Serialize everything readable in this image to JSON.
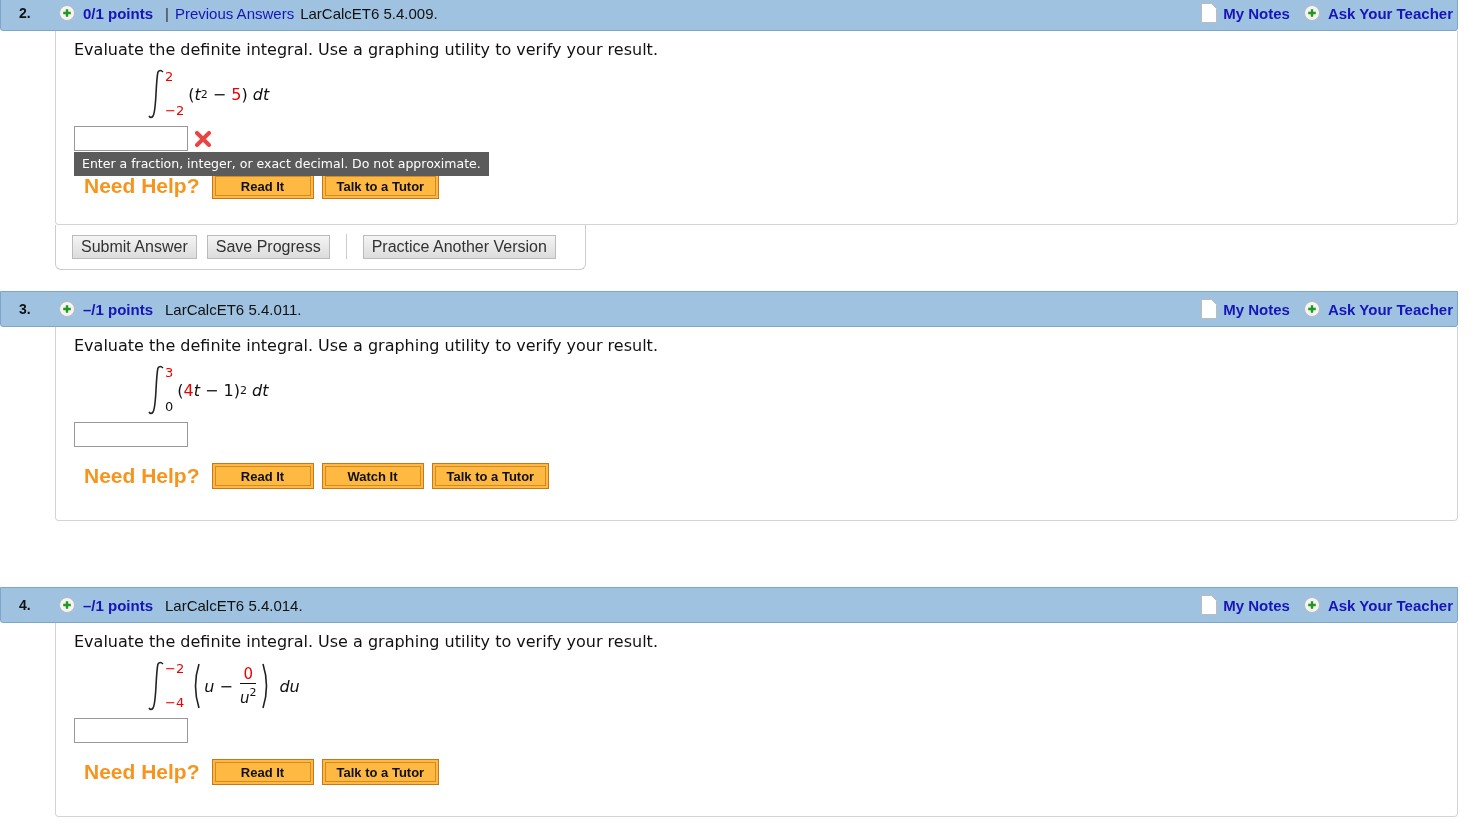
{
  "questions": [
    {
      "number": "2.",
      "points": "0/1 points",
      "separator": "|",
      "previous_answers": "Previous Answers",
      "code": "LarCalcET6 5.4.009.",
      "my_notes": "My Notes",
      "ask_teacher": "Ask Your Teacher",
      "prompt": "Evaluate the definite integral. Use a graphing utility to verify your result.",
      "integral": {
        "upper": {
          "text": "2",
          "given": true
        },
        "lower": {
          "text": "−2",
          "given": true
        },
        "pieces": [
          {
            "kind": "text",
            "text": "("
          },
          {
            "kind": "var",
            "text": "t"
          },
          {
            "kind": "sup",
            "text": "2"
          },
          {
            "kind": "text",
            "text": " − "
          },
          {
            "kind": "given",
            "text": "5"
          },
          {
            "kind": "text",
            "text": ")"
          },
          {
            "kind": "differential",
            "text": "dt"
          }
        ]
      },
      "answer": {
        "incorrect": true,
        "tooltip": "Enter a fraction, integer, or exact decimal. Do not approximate."
      },
      "help_label": "Need Help?",
      "help_buttons": [
        "Read It",
        "Talk to a Tutor"
      ],
      "button_groups": [
        [
          "Submit Answer",
          "Save Progress"
        ],
        [
          "Practice Another Version"
        ]
      ]
    },
    {
      "number": "3.",
      "points": "–/1 points",
      "code": "LarCalcET6 5.4.011.",
      "my_notes": "My Notes",
      "ask_teacher": "Ask Your Teacher",
      "prompt": "Evaluate the definite integral. Use a graphing utility to verify your result.",
      "integral": {
        "upper": {
          "text": "3",
          "given": true
        },
        "lower": {
          "text": "0",
          "given": false
        },
        "pieces": [
          {
            "kind": "text",
            "text": "("
          },
          {
            "kind": "given",
            "text": "4"
          },
          {
            "kind": "var",
            "text": "t"
          },
          {
            "kind": "text",
            "text": " − 1)"
          },
          {
            "kind": "sup",
            "text": "2"
          },
          {
            "kind": "differential",
            "text": "dt"
          }
        ]
      },
      "answer": {
        "incorrect": false
      },
      "help_label": "Need Help?",
      "help_buttons": [
        "Read It",
        "Watch It",
        "Talk to a Tutor"
      ]
    },
    {
      "number": "4.",
      "points": "–/1 points",
      "code": "LarCalcET6 5.4.014.",
      "my_notes": "My Notes",
      "ask_teacher": "Ask Your Teacher",
      "prompt": "Evaluate the definite integral. Use a graphing utility to verify your result.",
      "integral": {
        "upper": {
          "text": "−2",
          "given": true
        },
        "lower": {
          "text": "−4",
          "given": true
        },
        "pieces": [
          {
            "kind": "open"
          },
          {
            "kind": "var",
            "text": "u"
          },
          {
            "kind": "text",
            "text": " − "
          },
          {
            "kind": "frac",
            "numerator": [
              {
                "kind": "given",
                "text": "0"
              }
            ],
            "denominator": [
              {
                "kind": "var",
                "text": "u"
              },
              {
                "kind": "sup",
                "text": "2"
              }
            ]
          },
          {
            "kind": "close"
          },
          {
            "kind": "differential",
            "text": "du"
          }
        ]
      },
      "answer": {
        "incorrect": false
      },
      "help_label": "Need Help?",
      "help_buttons": [
        "Read It",
        "Talk to a Tutor"
      ]
    }
  ]
}
